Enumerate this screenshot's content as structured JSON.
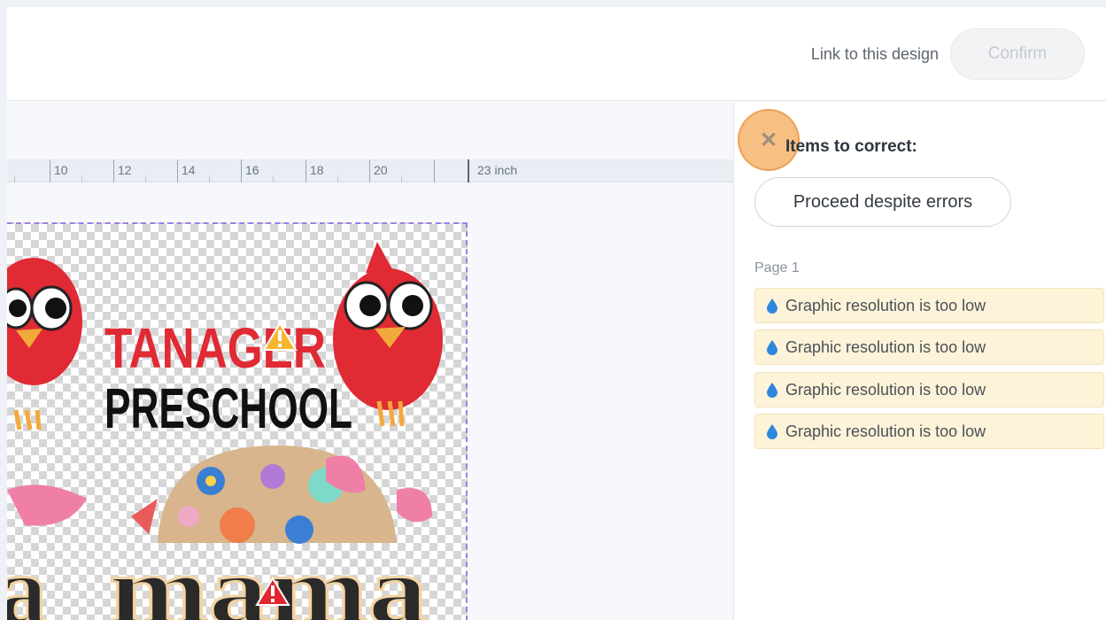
{
  "header": {
    "link_label": "Link to this design",
    "confirm_label": "Confirm"
  },
  "ruler": {
    "labels": [
      "10",
      "12",
      "14",
      "16",
      "18",
      "20"
    ],
    "end_label": "23 inch"
  },
  "canvas": {
    "texts": {
      "school_line1": "TANAGER",
      "school_line2": "PRESCHOOL",
      "bottom_word": "mama"
    }
  },
  "sidebar": {
    "title": "Items to correct:",
    "proceed_label": "Proceed despite errors",
    "page_label": "Page 1",
    "issues": [
      {
        "text": "Graphic resolution is too low"
      },
      {
        "text": "Graphic resolution is too low"
      },
      {
        "text": "Graphic resolution is too low"
      },
      {
        "text": "Graphic resolution is too low"
      }
    ]
  },
  "colors": {
    "accent_highlight": "#f5aa5a",
    "warning_bg": "#fdf3d9",
    "drop_icon": "#2e86de",
    "selection_border": "#9b7fe6"
  }
}
